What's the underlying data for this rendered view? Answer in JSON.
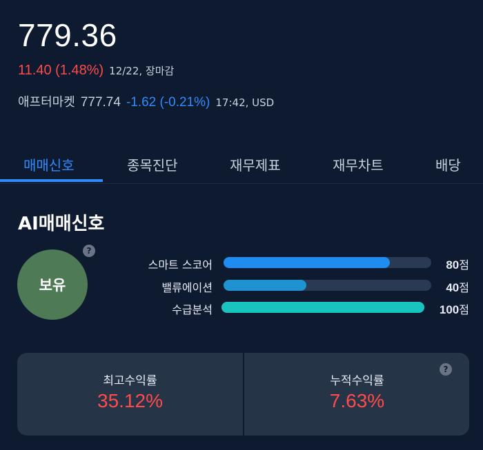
{
  "quote": {
    "price": "779.36",
    "change": "11.40 (1.48%)",
    "date_status": "12/22, 장마감",
    "after_label": "애프터마켓",
    "after_price": "777.74",
    "after_change": "-1.62 (-0.21%)",
    "after_time_currency": "17:42, USD"
  },
  "tabs": [
    {
      "label": "매매신호",
      "active": true
    },
    {
      "label": "종목진단",
      "active": false
    },
    {
      "label": "재무제표",
      "active": false
    },
    {
      "label": "재무차트",
      "active": false
    },
    {
      "label": "배당",
      "active": false
    }
  ],
  "signal": {
    "title": "AI매매신호",
    "help": "?",
    "status": "보유",
    "metrics": [
      {
        "label": "스마트 스코어",
        "score": 80,
        "value": "80",
        "unit": "점",
        "color": "#1e8cf0"
      },
      {
        "label": "밸류에이션",
        "score": 40,
        "value": "40",
        "unit": "점",
        "color": "#1f93d1"
      },
      {
        "label": "수급분석",
        "score": 100,
        "value": "100",
        "unit": "점",
        "color": "#19c3c0"
      }
    ]
  },
  "returns": {
    "help": "?",
    "max_label": "최고수익률",
    "max_value": "35.12%",
    "cum_label": "누적수익률",
    "cum_value": "7.63%"
  },
  "colors": {
    "background": "#0e1a2f",
    "up": "#ff4b4b",
    "down": "#2f8cff",
    "accent": "#2f8cff",
    "card": "#263447",
    "hold": "#4f7a56"
  }
}
